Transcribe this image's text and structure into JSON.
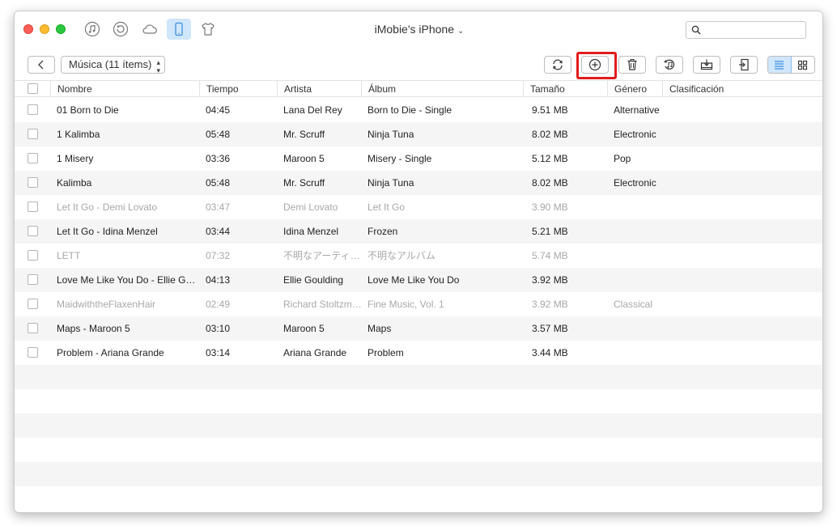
{
  "window": {
    "device_title": "iMobie's iPhone",
    "nav_icons": [
      "music-note-icon",
      "restore-icon",
      "cloud-icon",
      "phone-icon",
      "tshirt-icon"
    ],
    "search_placeholder": ""
  },
  "toolbar": {
    "category": "Música (11 ítems)",
    "buttons": [
      "refresh-icon",
      "add-icon",
      "trash-icon",
      "to-itunes-icon",
      "to-computer-icon",
      "export-icon"
    ],
    "view_modes": [
      "list-view-icon",
      "grid-view-icon"
    ],
    "highlight_color": "#e21b1b"
  },
  "table": {
    "columns": [
      "Nombre",
      "Tiempo",
      "Artista",
      "Álbum",
      "Tamaño",
      "Género",
      "Clasificación"
    ],
    "rows": [
      {
        "name": "01 Born to Die",
        "time": "04:45",
        "artist": "Lana Del Rey",
        "album": "Born to Die - Single",
        "size": "9.51 MB",
        "genre": "Alternative",
        "dim": false
      },
      {
        "name": "1 Kalimba",
        "time": "05:48",
        "artist": "Mr. Scruff",
        "album": "Ninja Tuna",
        "size": "8.02 MB",
        "genre": "Electronic",
        "dim": false
      },
      {
        "name": "1 Misery",
        "time": "03:36",
        "artist": "Maroon 5",
        "album": "Misery - Single",
        "size": "5.12 MB",
        "genre": "Pop",
        "dim": false
      },
      {
        "name": "Kalimba",
        "time": "05:48",
        "artist": "Mr. Scruff",
        "album": "Ninja Tuna",
        "size": "8.02 MB",
        "genre": "Electronic",
        "dim": false
      },
      {
        "name": "Let It Go - Demi Lovato",
        "time": "03:47",
        "artist": "Demi Lovato",
        "album": "Let It Go",
        "size": "3.90 MB",
        "genre": "",
        "dim": true
      },
      {
        "name": "Let It Go - Idina Menzel",
        "time": "03:44",
        "artist": "Idina Menzel",
        "album": "Frozen",
        "size": "5.21 MB",
        "genre": "",
        "dim": false
      },
      {
        "name": "LETT",
        "time": "07:32",
        "artist": "不明なアーティスト",
        "album": "不明なアルバム",
        "size": "5.74 MB",
        "genre": "",
        "dim": true
      },
      {
        "name": "Love Me Like You Do - Ellie Goulding",
        "time": "04:13",
        "artist": "Ellie Goulding",
        "album": "Love Me Like You Do",
        "size": "3.92 MB",
        "genre": "",
        "dim": false
      },
      {
        "name": "MaidwiththeFlaxenHair",
        "time": "02:49",
        "artist": "Richard Stoltzman",
        "album": "Fine Music, Vol. 1",
        "size": "3.92 MB",
        "genre": "Classical",
        "dim": true
      },
      {
        "name": "Maps - Maroon 5",
        "time": "03:10",
        "artist": "Maroon 5",
        "album": "Maps",
        "size": "3.57 MB",
        "genre": "",
        "dim": false
      },
      {
        "name": "Problem - Ariana Grande",
        "time": "03:14",
        "artist": "Ariana Grande",
        "album": "Problem",
        "size": "3.44 MB",
        "genre": "",
        "dim": false
      }
    ]
  }
}
